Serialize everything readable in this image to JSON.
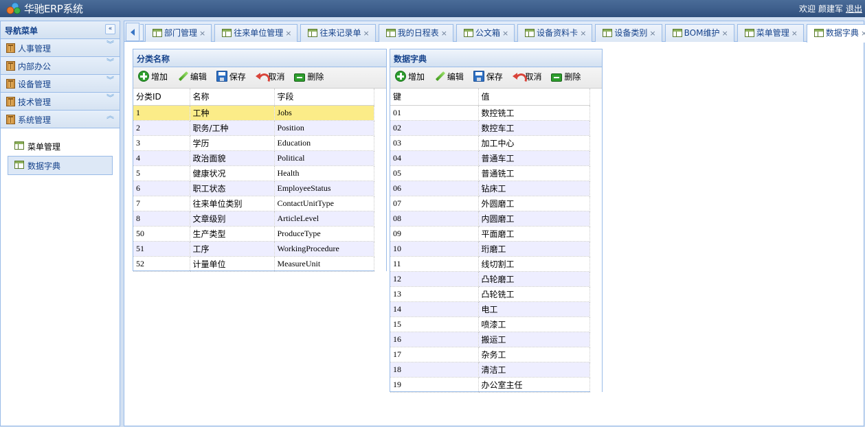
{
  "header": {
    "app_title": "华驰ERP系统",
    "welcome": "欢迎",
    "user_name": "颜建军",
    "logout": "退出"
  },
  "sidebar": {
    "title": "导航菜单",
    "collapse_icon": "double-chevron-left-icon",
    "sections": [
      {
        "label": "人事管理",
        "expanded": false
      },
      {
        "label": "内部办公",
        "expanded": false
      },
      {
        "label": "设备管理",
        "expanded": false
      },
      {
        "label": "技术管理",
        "expanded": false
      },
      {
        "label": "系统管理",
        "expanded": true
      }
    ],
    "sub_items": [
      {
        "label": "菜单管理",
        "active": false
      },
      {
        "label": "数据字典",
        "active": true
      }
    ]
  },
  "tabs": [
    {
      "label": "部门管理",
      "active": false
    },
    {
      "label": "往来单位管理",
      "active": false
    },
    {
      "label": "往来记录单",
      "active": false
    },
    {
      "label": "我的日程表",
      "active": false
    },
    {
      "label": "公文箱",
      "active": false
    },
    {
      "label": "设备资料卡",
      "active": false
    },
    {
      "label": "设备类别",
      "active": false
    },
    {
      "label": "BOM维护",
      "active": false
    },
    {
      "label": "菜单管理",
      "active": false
    },
    {
      "label": "数据字典",
      "active": true
    }
  ],
  "close_glyph": "×",
  "toolbar": {
    "add": "增加",
    "edit": "编辑",
    "save": "保存",
    "cancel": "取消",
    "delete": "删除"
  },
  "category_panel": {
    "title": "分类名称",
    "columns": [
      "分类ID",
      "名称",
      "字段"
    ],
    "selected_index": 0,
    "rows": [
      {
        "id": "1",
        "name": "工种",
        "field": "Jobs"
      },
      {
        "id": "2",
        "name": "职务/工种",
        "field": "Position"
      },
      {
        "id": "3",
        "name": "学历",
        "field": "Education"
      },
      {
        "id": "4",
        "name": "政治面貌",
        "field": "Political"
      },
      {
        "id": "5",
        "name": "健康状况",
        "field": "Health"
      },
      {
        "id": "6",
        "name": "职工状态",
        "field": "EmployeeStatus"
      },
      {
        "id": "7",
        "name": "往来单位类别",
        "field": "ContactUnitType"
      },
      {
        "id": "8",
        "name": "文章级别",
        "field": "ArticleLevel"
      },
      {
        "id": "50",
        "name": "生产类型",
        "field": "ProduceType"
      },
      {
        "id": "51",
        "name": "工序",
        "field": "WorkingProcedure"
      },
      {
        "id": "52",
        "name": "计量单位",
        "field": "MeasureUnit"
      }
    ]
  },
  "dict_panel": {
    "title": "数据字典",
    "columns": [
      "键",
      "值"
    ],
    "rows": [
      {
        "key": "01",
        "value": "数控铣工"
      },
      {
        "key": "02",
        "value": "数控车工"
      },
      {
        "key": "03",
        "value": "加工中心"
      },
      {
        "key": "04",
        "value": "普通车工"
      },
      {
        "key": "05",
        "value": "普通铣工"
      },
      {
        "key": "06",
        "value": "钻床工"
      },
      {
        "key": "07",
        "value": "外圆磨工"
      },
      {
        "key": "08",
        "value": "内圆磨工"
      },
      {
        "key": "09",
        "value": "平面磨工"
      },
      {
        "key": "10",
        "value": "珩磨工"
      },
      {
        "key": "11",
        "value": "线切割工"
      },
      {
        "key": "12",
        "value": "凸轮磨工"
      },
      {
        "key": "13",
        "value": "凸轮铣工"
      },
      {
        "key": "14",
        "value": "电工"
      },
      {
        "key": "15",
        "value": "喷漆工"
      },
      {
        "key": "16",
        "value": "搬运工"
      },
      {
        "key": "17",
        "value": "杂务工"
      },
      {
        "key": "18",
        "value": "清洁工"
      },
      {
        "key": "19",
        "value": "办公室主任"
      }
    ]
  }
}
